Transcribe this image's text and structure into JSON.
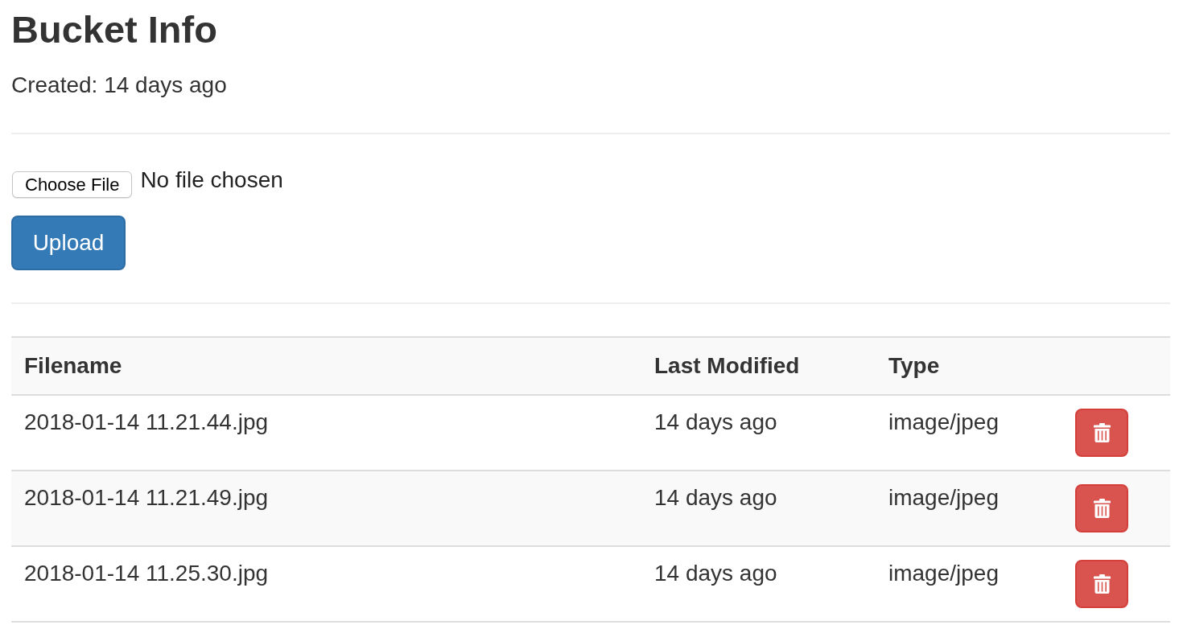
{
  "title": "Bucket Info",
  "created": "Created: 14 days ago",
  "file_input": {
    "button": "Choose File",
    "status": "No file chosen"
  },
  "upload_button": "Upload",
  "table": {
    "columns": [
      "Filename",
      "Last Modified",
      "Type"
    ],
    "rows": [
      {
        "filename": "2018-01-14 11.21.44.jpg",
        "last_modified": "14 days ago",
        "type": "image/jpeg"
      },
      {
        "filename": "2018-01-14 11.21.49.jpg",
        "last_modified": "14 days ago",
        "type": "image/jpeg"
      },
      {
        "filename": "2018-01-14 11.25.30.jpg",
        "last_modified": "14 days ago",
        "type": "image/jpeg"
      }
    ]
  }
}
